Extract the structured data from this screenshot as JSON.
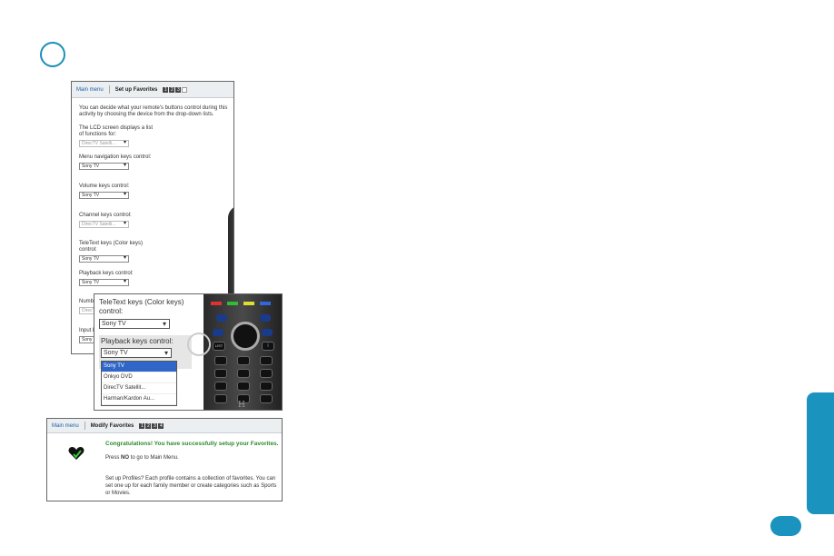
{
  "panel1": {
    "header": {
      "main_menu": "Main menu",
      "title": "Set up Favorites",
      "steps": [
        "1",
        "2",
        "3"
      ]
    },
    "intro": "You can decide what your remote's buttons control during this activity by choosing the device from the drop-down lists.",
    "groups": [
      {
        "label": "The LCD screen displays a list of functions for:",
        "value": "DirecTV Satelli...",
        "disabled": true
      },
      {
        "label": "Menu navigation keys control:",
        "value": "Sony TV",
        "disabled": false
      },
      {
        "label": "Volume keys control:",
        "value": "Sony TV",
        "disabled": false
      },
      {
        "label": "Channel keys control:",
        "value": "DirecTV Satelli...",
        "disabled": true
      },
      {
        "label": "TeleText keys (Color keys) control:",
        "value": "Sony TV",
        "disabled": false
      },
      {
        "label": "Playback keys control:",
        "value": "Sony TV",
        "disabled": false
      },
      {
        "label": "Number keys control:",
        "value": "DirecTV Satelli...",
        "disabled": true
      },
      {
        "label": "Input keys control:",
        "value": "Sony TV",
        "disabled": false
      }
    ]
  },
  "panel2": {
    "teletext_label": "TeleText keys (Color keys) control:",
    "teletext_value": "Sony TV",
    "playback_label": "Playback keys control:",
    "playback_value": "Sony TV",
    "options": [
      "Sony TV",
      "Onkyo DVD",
      "DirecTV Satellit...",
      "Harman/Kardon Au..."
    ],
    "remote_text": {
      "list": "LIST",
      "info": "i",
      "logo": "H"
    }
  },
  "panel3": {
    "header": {
      "main_menu": "Main menu",
      "title": "Modify Favorites",
      "steps": [
        "1",
        "2",
        "3",
        "4"
      ]
    },
    "congrats": "Congratulations! You have successfully setup your Favorites.",
    "back_pre": "Press ",
    "back_key": "NO",
    "back_post": " to go to Main Menu.",
    "profiles": "Set up Profiles? Each profile contains a collection of favorites. You can set one up for each family member or create categories such as Sports or Movies."
  },
  "colors": {
    "accent": "#1a94bf",
    "highlight": "#2f66c7",
    "success": "#2d8a2d"
  }
}
